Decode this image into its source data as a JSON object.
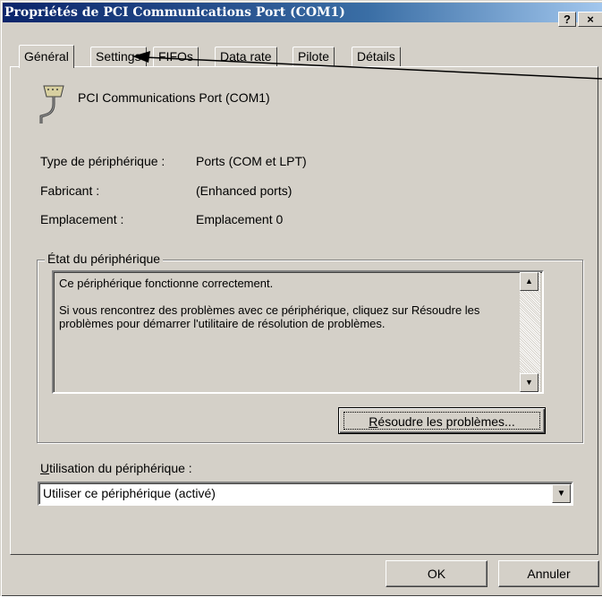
{
  "window": {
    "title": "Propriétés de PCI Communications Port (COM1)",
    "help_label": "?",
    "close_label": "×"
  },
  "tabs": [
    {
      "label": "Général",
      "active": true
    },
    {
      "label": "Settings"
    },
    {
      "label": "FIFOs"
    },
    {
      "label": "Data rate"
    },
    {
      "label": "Pilote"
    },
    {
      "label": "Détails"
    }
  ],
  "device": {
    "icon": "serial-port-icon",
    "name": "PCI Communications Port (COM1)"
  },
  "properties": [
    {
      "label": "Type de périphérique :",
      "value": "Ports (COM et LPT)"
    },
    {
      "label": "Fabricant :",
      "value": "(Enhanced ports)"
    },
    {
      "label": "Emplacement :",
      "value": "Emplacement 0"
    }
  ],
  "status": {
    "group_label": "État du périphérique",
    "line1": "Ce périphérique fonctionne correctement.",
    "line2": "Si vous rencontrez des problèmes avec ce périphérique, cliquez sur Résoudre les problèmes pour démarrer l'utilitaire de résolution de problèmes.",
    "troubleshoot_mnemonic": "R",
    "troubleshoot_rest": "ésoudre les problèmes..."
  },
  "usage": {
    "label_mnemonic": "U",
    "label_rest": "tilisation du périphérique :",
    "selected": "Utiliser ce périphérique (activé)"
  },
  "footer": {
    "ok_label": "OK",
    "cancel_label": "Annuler"
  }
}
